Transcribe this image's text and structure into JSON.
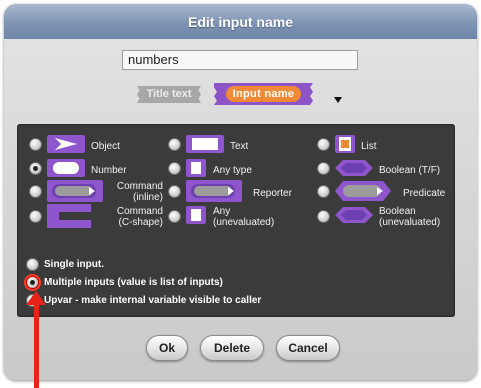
{
  "dialog": {
    "title": "Edit input name",
    "name_value": "numbers",
    "title_text_label": "Title text",
    "input_name_label": "Input name"
  },
  "types": [
    {
      "label": "Object",
      "icon": "object-arrow-icon"
    },
    {
      "label": "Text",
      "icon": "text-slot-icon"
    },
    {
      "label": "List",
      "icon": "list-icon"
    },
    {
      "label": "Number",
      "icon": "number-slot-icon",
      "selected": true
    },
    {
      "label": "Any type",
      "icon": "any-slot-icon"
    },
    {
      "label": "Boolean (T/F)",
      "icon": "boolean-slot-icon"
    },
    {
      "label": "Command\n(inline)",
      "icon": "command-inline-icon"
    },
    {
      "label": "Reporter",
      "icon": "reporter-slot-icon"
    },
    {
      "label": "Predicate",
      "icon": "predicate-slot-icon"
    },
    {
      "label": "Command\n(C-shape)",
      "icon": "command-c-shape-icon"
    },
    {
      "label": "Any\n(unevaluated)",
      "icon": "any-unevaluated-icon"
    },
    {
      "label": "Boolean\n(unevaluated)",
      "icon": "boolean-unevaluated-icon"
    }
  ],
  "arity": {
    "single": "Single input.",
    "multiple": "Multiple inputs (value is list of inputs)",
    "upvar": "Upvar - make internal variable visible to caller",
    "selected": "multiple"
  },
  "buttons": {
    "ok": "Ok",
    "delete": "Delete",
    "cancel": "Cancel"
  },
  "colors": {
    "title_bar": "#7e93b3",
    "block_purple": "#8d54c8",
    "input_name_orange": "#f08a36",
    "panel_bg": "#3b3b3b",
    "annotation_red": "#e8241a"
  }
}
